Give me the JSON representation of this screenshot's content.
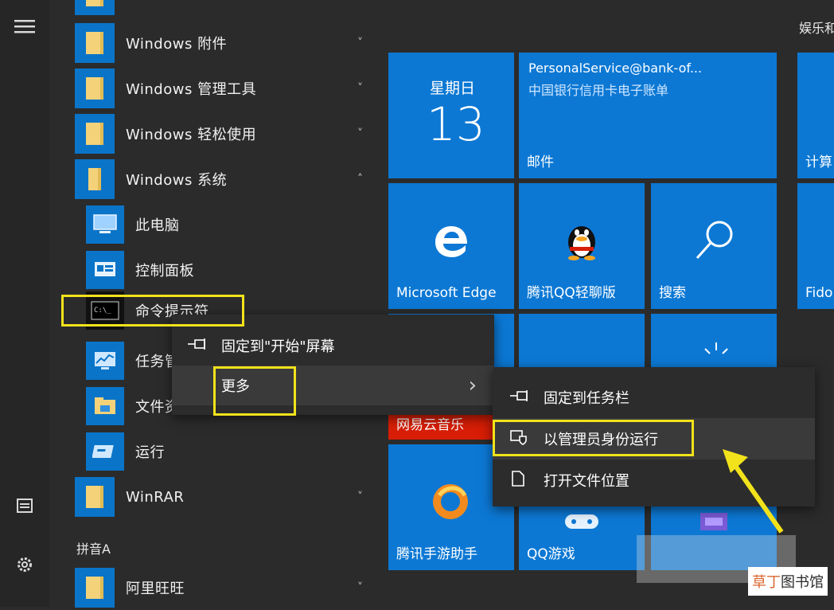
{
  "left_rail": {
    "icons": [
      "hamburger-icon",
      "document-icon",
      "gear-icon"
    ]
  },
  "app_list": {
    "rows": [
      {
        "label": "Windows 附件",
        "chevron": "˅"
      },
      {
        "label": "Windows 管理工具",
        "chevron": "˅"
      },
      {
        "label": "Windows 轻松使用",
        "chevron": "˅"
      },
      {
        "label": "Windows 系统",
        "chevron": "˄"
      },
      {
        "label": "此电脑"
      },
      {
        "label": "控制面板"
      },
      {
        "label": "命令提示符"
      },
      {
        "label": "任务管理器"
      },
      {
        "label": "文件资源管理器"
      },
      {
        "label": "运行"
      },
      {
        "label": "WinRAR",
        "chevron": "˅"
      },
      {
        "label": "阿里旺旺",
        "chevron": "˅"
      }
    ],
    "section_letter": "拼音A"
  },
  "tiles": {
    "header_right": "娱乐和",
    "calendar": {
      "day": "星期日",
      "date": "13"
    },
    "mail": {
      "sender": "PersonalService@bank-of...",
      "subject": "中国银行信用卡电子账单",
      "label": "邮件"
    },
    "calculator": {
      "label": "计算"
    },
    "edge": {
      "label": "Microsoft Edge"
    },
    "qq": {
      "label": "腾讯QQ轻聊版"
    },
    "search": {
      "label": "搜索"
    },
    "fido": {
      "label": "Fido"
    },
    "netease": {
      "label": "网易云音乐"
    },
    "tencent_game_helper": {
      "label": "腾讯手游助手"
    },
    "qq_games": {
      "label": "QQ游戏"
    }
  },
  "context_menu_1": {
    "items": [
      {
        "label": "固定到\"开始\"屏幕",
        "icon": "pin-icon"
      },
      {
        "label": "更多",
        "submenu_arrow": "›"
      }
    ]
  },
  "context_menu_2": {
    "items": [
      {
        "label": "固定到任务栏",
        "icon": "pin-icon"
      },
      {
        "label": "以管理员身份运行",
        "icon": "admin-shield-icon"
      },
      {
        "label": "打开文件位置",
        "icon": "file-icon"
      }
    ]
  },
  "watermark": {
    "part1": "草丁",
    "part2": "图书馆"
  },
  "colors": {
    "tile_blue": "#0c78d4",
    "highlight_yellow": "#f2e21b",
    "netease_red": "#d81e06",
    "menu_bg": "#2c2c2c",
    "start_bg": "#2b2b2b"
  }
}
